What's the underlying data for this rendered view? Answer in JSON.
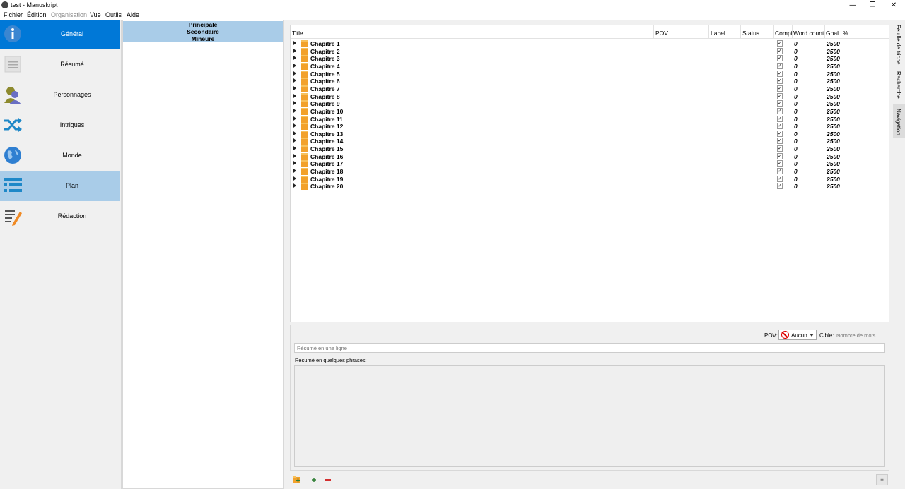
{
  "window": {
    "title": "test - Manuskript",
    "minimize": "—",
    "restore": "❐",
    "close": "✕"
  },
  "menu": [
    {
      "label": "Fichier",
      "disabled": false
    },
    {
      "label": "Édition",
      "disabled": false
    },
    {
      "label": "Organisation",
      "disabled": true
    },
    {
      "label": "Vue",
      "disabled": false
    },
    {
      "label": "Outils",
      "disabled": false
    },
    {
      "label": "Aide",
      "disabled": false
    }
  ],
  "nav": [
    {
      "label": "Général",
      "icon": "info-icon",
      "state": "active"
    },
    {
      "label": "Résumé",
      "icon": "document-icon",
      "state": ""
    },
    {
      "label": "Personnages",
      "icon": "person-icon",
      "state": ""
    },
    {
      "label": "Intrigues",
      "icon": "shuffle-icon",
      "state": ""
    },
    {
      "label": "Monde",
      "icon": "globe-icon",
      "state": ""
    },
    {
      "label": "Plan",
      "icon": "outline-icon",
      "state": "selected"
    },
    {
      "label": "Rédaction",
      "icon": "write-icon",
      "state": ""
    }
  ],
  "plot_filter": [
    "Principale",
    "Secondaire",
    "Mineure"
  ],
  "columns": [
    "Title",
    "POV",
    "Label",
    "Status",
    "Compi",
    "Word count",
    "Goal",
    "%"
  ],
  "rows": [
    {
      "title": "Chapitre 1",
      "wc": "0",
      "goal": "2500",
      "compile": "✓"
    },
    {
      "title": "Chapitre 2",
      "wc": "0",
      "goal": "2500",
      "compile": "✓"
    },
    {
      "title": "Chapitre 3",
      "wc": "0",
      "goal": "2500",
      "compile": "✓"
    },
    {
      "title": "Chapitre 4",
      "wc": "0",
      "goal": "2500",
      "compile": "✓"
    },
    {
      "title": "Chapitre 5",
      "wc": "0",
      "goal": "2500",
      "compile": "✓"
    },
    {
      "title": "Chapitre 6",
      "wc": "0",
      "goal": "2500",
      "compile": "✓"
    },
    {
      "title": "Chapitre 7",
      "wc": "0",
      "goal": "2500",
      "compile": "✓"
    },
    {
      "title": "Chapitre 8",
      "wc": "0",
      "goal": "2500",
      "compile": "✓"
    },
    {
      "title": "Chapitre 9",
      "wc": "0",
      "goal": "2500",
      "compile": "✓"
    },
    {
      "title": "Chapitre 10",
      "wc": "0",
      "goal": "2500",
      "compile": "✓"
    },
    {
      "title": "Chapitre 11",
      "wc": "0",
      "goal": "2500",
      "compile": "✓"
    },
    {
      "title": "Chapitre 12",
      "wc": "0",
      "goal": "2500",
      "compile": "✓"
    },
    {
      "title": "Chapitre 13",
      "wc": "0",
      "goal": "2500",
      "compile": "✓"
    },
    {
      "title": "Chapitre 14",
      "wc": "0",
      "goal": "2500",
      "compile": "✓"
    },
    {
      "title": "Chapitre 15",
      "wc": "0",
      "goal": "2500",
      "compile": "✓"
    },
    {
      "title": "Chapitre 16",
      "wc": "0",
      "goal": "2500",
      "compile": "✓"
    },
    {
      "title": "Chapitre 17",
      "wc": "0",
      "goal": "2500",
      "compile": "✓"
    },
    {
      "title": "Chapitre 18",
      "wc": "0",
      "goal": "2500",
      "compile": "✓"
    },
    {
      "title": "Chapitre 19",
      "wc": "0",
      "goal": "2500",
      "compile": "✓"
    },
    {
      "title": "Chapitre 20",
      "wc": "0",
      "goal": "2500",
      "compile": "✓"
    }
  ],
  "side_tabs": [
    {
      "label": "Feuille de triche",
      "selected": false
    },
    {
      "label": "Recherche",
      "selected": false
    },
    {
      "label": "Navigation",
      "selected": true
    }
  ],
  "props": {
    "pov_label": "POV:",
    "pov_value": "Aucun",
    "cible_label": "Cible:",
    "cible_placeholder": "Nombre de mots",
    "oneline_placeholder": "Résumé en une ligne",
    "phrases_label": "Résumé en quelques phrases:"
  },
  "colors": {
    "active": "#0078d7",
    "selected": "#a9cce8",
    "folder": "#f2a12b",
    "remove": "#d32f2f",
    "add": "#2e7d32"
  }
}
